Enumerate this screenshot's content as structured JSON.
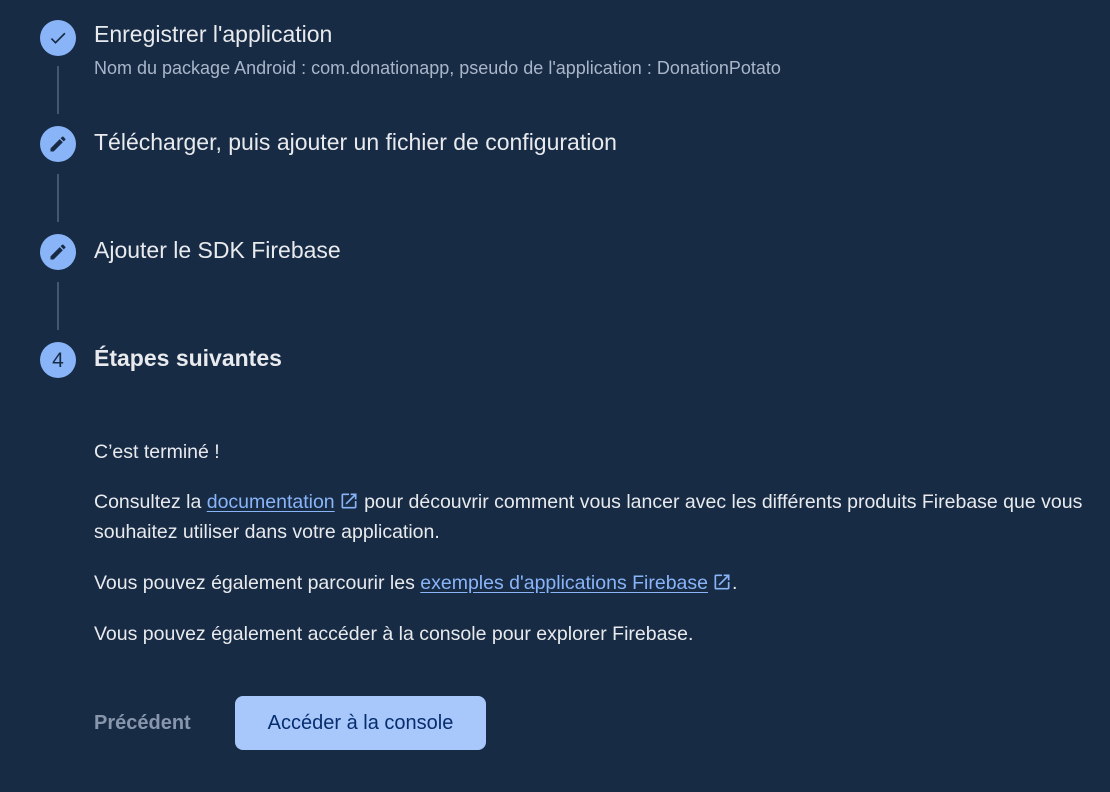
{
  "steps": [
    {
      "status": "completed",
      "icon": "check-icon",
      "title": "Enregistrer l'application",
      "subtitle": "Nom du package Android : com.donationapp, pseudo de l'application : DonationPotato"
    },
    {
      "status": "edit",
      "icon": "pencil-icon",
      "title": "Télécharger, puis ajouter un fichier de configuration"
    },
    {
      "status": "edit",
      "icon": "pencil-icon",
      "title": "Ajouter le SDK Firebase"
    },
    {
      "status": "current",
      "number": "4",
      "title": "Étapes suivantes"
    }
  ],
  "content": {
    "done_text": "C’est terminé !",
    "docs_prefix": "Consultez la ",
    "docs_link": "documentation",
    "docs_suffix": " pour découvrir comment vous lancer avec les différents produits Firebase que vous souhaitez utiliser dans votre application.",
    "samples_prefix": "Vous pouvez également parcourir les ",
    "samples_link": "exemples d'applications Firebase",
    "samples_suffix": ".",
    "console_text": "Vous pouvez également accéder à la console pour explorer Firebase."
  },
  "actions": {
    "previous_label": "Précédent",
    "primary_label": "Accéder à la console"
  },
  "colors": {
    "background": "#172b45",
    "accent": "#8ab4f8",
    "primary_button": "#a8c7fa",
    "connector": "#45566f"
  }
}
